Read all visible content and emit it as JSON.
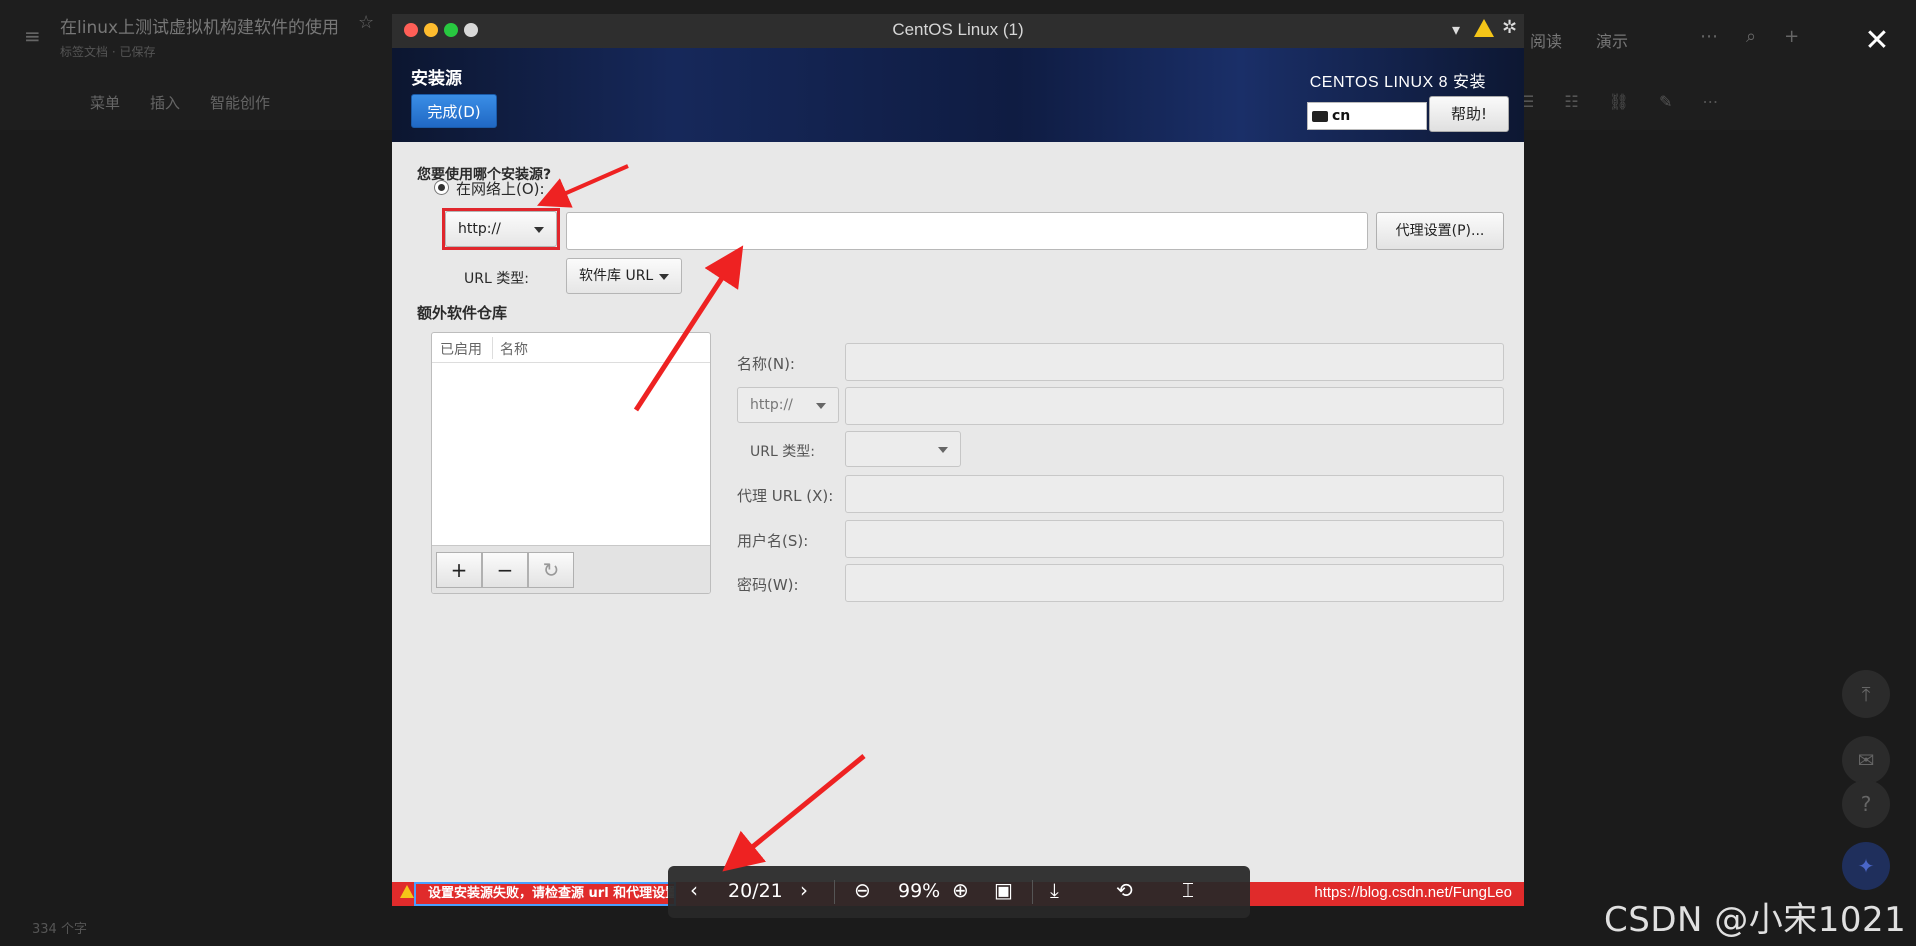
{
  "background_editor": {
    "doc_title": "在linux上测试虚拟机构建软件的使用",
    "doc_sub": "标签文档 · 已保存",
    "toolbar": [
      "菜单",
      "插入",
      "智能创作"
    ],
    "read_label": "阅读",
    "demo_label": "演示",
    "word_count": "334 个字"
  },
  "vm_window": {
    "title": "CentOS Linux (1)"
  },
  "installer": {
    "spoke_title": "安装源",
    "done_button": "完成(D)",
    "product_title": "CENTOS LINUX 8 安装",
    "keyboard_layout": "cn",
    "help_button": "帮助!",
    "question": "您要使用哪个安装源?",
    "network_option": "在网络上(O):",
    "protocol_value": "http://",
    "url_value": "",
    "proxy_button": "代理设置(P)...",
    "url_type_label": "URL 类型:",
    "url_type_value": "软件库 URL",
    "extra_repos_title": "额外软件仓库",
    "repo_columns": [
      "已启用",
      "名称"
    ],
    "add_button": "+",
    "remove_button": "−",
    "refresh_button": "↻",
    "repo_form": {
      "name_label": "名称(N):",
      "protocol_value": "http://",
      "url_type_label": "URL 类型:",
      "proxy_label": "代理 URL (X):",
      "user_label": "用户名(S):",
      "password_label": "密码(W):"
    },
    "status_message": "设置安装源失败，请检查源 url 和代理设置",
    "status_url": "https://blog.csdn.net/FungLeo"
  },
  "viewer": {
    "page": "20/21",
    "zoom": "99%"
  },
  "watermark": "CSDN @小宋1021",
  "colors": {
    "accent_red": "#e0262c",
    "done_blue": "#2a7ad6",
    "status_red": "#e02b2b"
  }
}
